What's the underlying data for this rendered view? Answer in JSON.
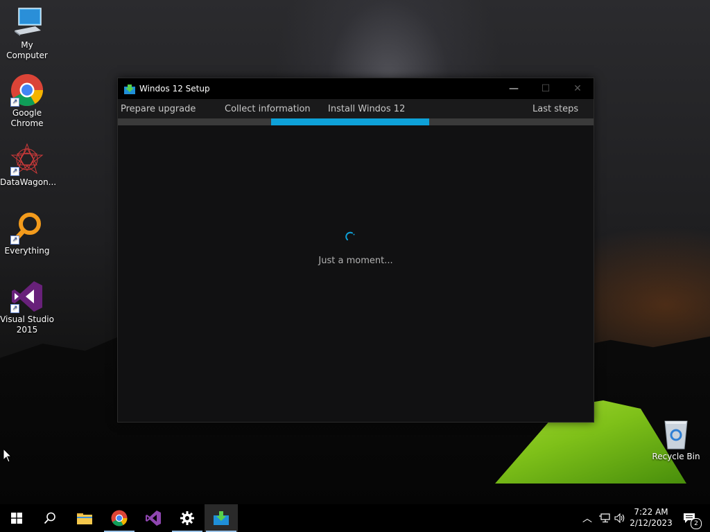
{
  "desktop": {
    "icons": [
      {
        "label": "My Computer",
        "icon": "computer-icon"
      },
      {
        "label": "Google Chrome",
        "icon": "chrome-icon"
      },
      {
        "label": "DataWagon...",
        "icon": "datawagon-icon"
      },
      {
        "label": "Everything",
        "icon": "everything-search-icon"
      },
      {
        "label": "Visual Studio 2015",
        "icon": "visual-studio-icon"
      },
      {
        "label": "Recycle Bin",
        "icon": "recycle-bin-icon"
      }
    ]
  },
  "setup_window": {
    "title": "Windos 12 Setup",
    "steps": [
      "Prepare upgrade",
      "Collect information",
      "Install Windos 12",
      "Last steps"
    ],
    "active_step": "Install Windos 12",
    "status_text": "Just a moment...",
    "controls": {
      "minimize": "—",
      "maximize": "☐",
      "close": "✕"
    },
    "accent_color": "#0ea1d8"
  },
  "taskbar": {
    "apps": [
      "start-icon",
      "search-icon",
      "file-explorer-icon",
      "chrome-icon",
      "visual-studio-icon",
      "settings-icon",
      "setup-icon"
    ],
    "clock": {
      "time": "7:22 AM",
      "date": "2/12/2023"
    },
    "notification_count": "2"
  }
}
